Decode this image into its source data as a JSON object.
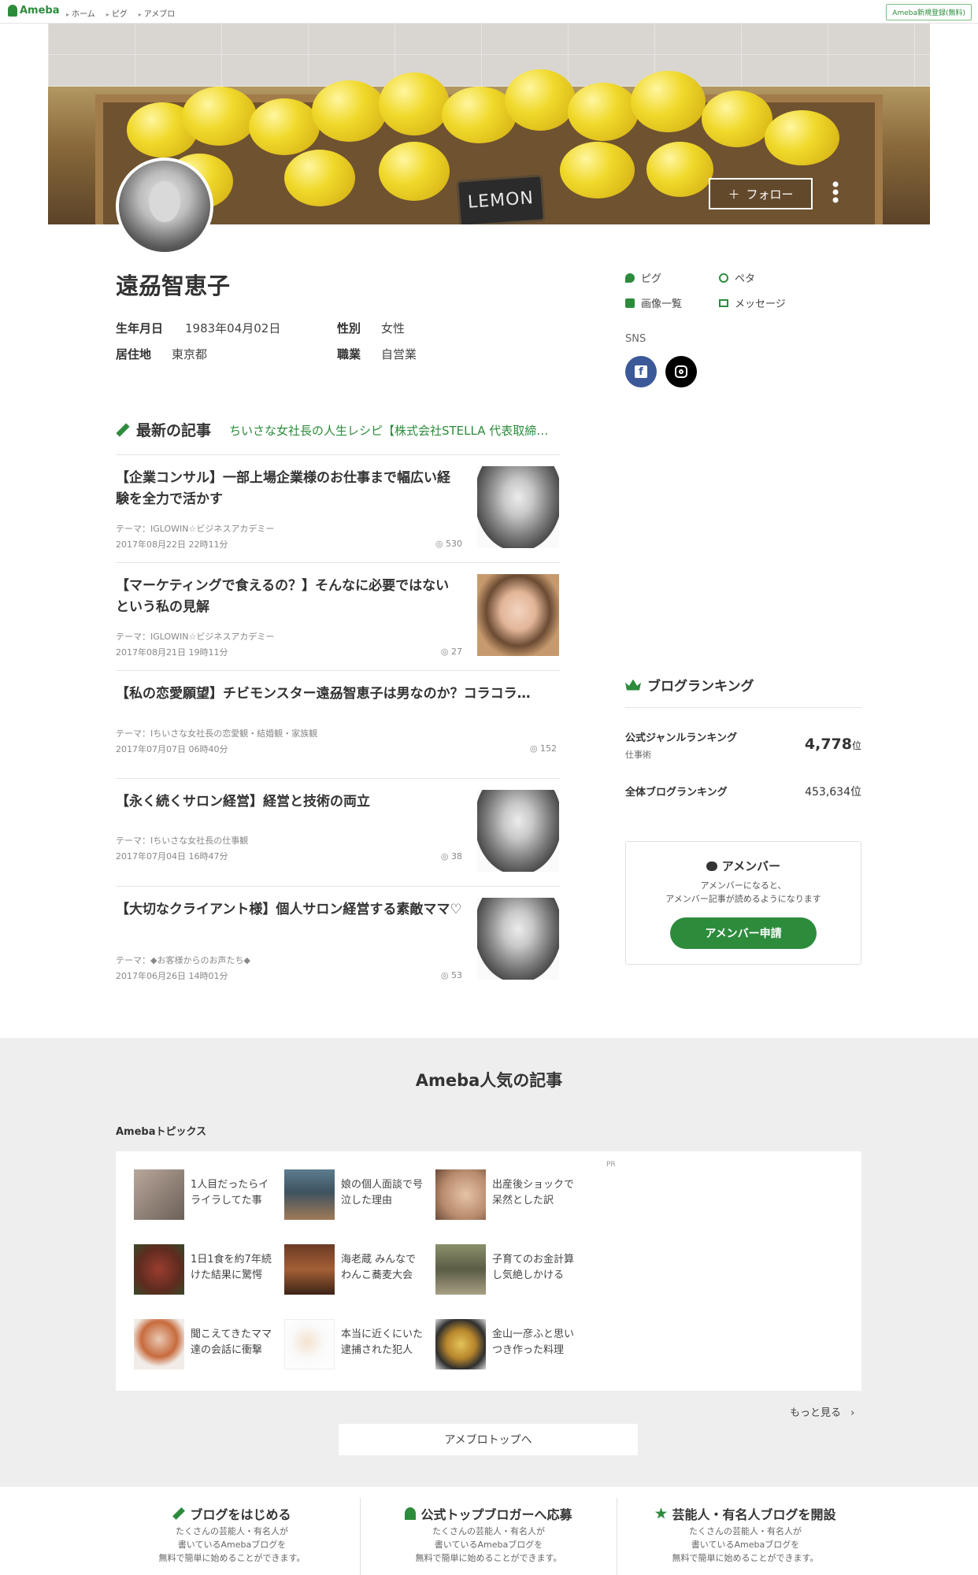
{
  "topbar": {
    "logo": "Ameba",
    "crumbs": [
      "ホーム",
      "ピグ",
      "アメブロ"
    ],
    "signup": "Ameba新規登録(無料)"
  },
  "header": {
    "sign_text": "LEMON",
    "follow_label": "フォロー",
    "follow_plus": "＋",
    "more": "⋮"
  },
  "profile": {
    "name": "遠刕智恵子",
    "birthday_label": "生年月日",
    "birthday": "1983年04月02日",
    "gender_label": "性別",
    "gender": "女性",
    "residence_label": "居住地",
    "residence": "東京都",
    "job_label": "職業",
    "job": "自営業"
  },
  "side_links": {
    "pig": "ピグ",
    "peta": "ペタ",
    "images": "画像一覧",
    "message": "メッセージ",
    "sns_label": "SNS"
  },
  "latest": {
    "title": "最新の記事",
    "blog_title": "ちいさな女社長の人生レシピ【株式会社STELLA 代表取締役 遠刕智恵子】",
    "articles": [
      {
        "title": "【企業コンサル】一部上場企業様のお仕事まで幅広い経験を全力で活かす",
        "theme": "テーマ：ⅠGLOWIN☆ビジネスアカデミー",
        "date": "2017年08月22日 22時11分",
        "views": "530"
      },
      {
        "title": "【マーケティングで食えるの？】そんなに必要ではないという私の見解",
        "theme": "テーマ：ⅠGLOWIN☆ビジネスアカデミー",
        "date": "2017年08月21日 19時11分",
        "views": "27"
      },
      {
        "title": "【私の恋愛願望】チビモンスター遠刕智恵子は男なのか？コラコラ…",
        "theme": "テーマ：Ⅰちいさな女社長の恋愛観・結婚観・家族観",
        "date": "2017年07月07日 06時40分",
        "views": "152"
      },
      {
        "title": "【永く続くサロン経営】経営と技術の両立",
        "theme": "テーマ：Ⅰちいさな女社長の仕事観",
        "date": "2017年07月04日 16時47分",
        "views": "38"
      },
      {
        "title": "【大切なクライアント様】個人サロン経営する素敵ママ♡",
        "theme": "テーマ：◆お客様からのお声たち◆",
        "date": "2017年06月26日 14時01分",
        "views": "53"
      }
    ]
  },
  "ranking": {
    "title": "ブログランキング",
    "genre_label": "公式ジャンルランキング",
    "genre_sub": "仕事術",
    "genre_rank": "4,778",
    "rank_unit": "位",
    "overall_label": "全体ブログランキング",
    "overall_rank": "453,634位"
  },
  "amember": {
    "title": "アメンバー",
    "desc_line1": "アメンバーになると、",
    "desc_line2": "アメンバー記事が読めるようになります",
    "button": "アメンバー申請"
  },
  "popular": {
    "title": "Ameba人気の記事",
    "topics_label": "Amebaトピックス",
    "pr": "PR",
    "topics": [
      [
        "1人目だったらイ",
        "ライラしてた事"
      ],
      [
        "娘の個人面談で号",
        "泣した理由"
      ],
      [
        "出産後ショックで",
        "呆然とした訳"
      ],
      [
        "1日1食を約7年続",
        "けた結果に驚愕"
      ],
      [
        "海老蔵 みんなで",
        "わんこ蕎麦大会"
      ],
      [
        "子育てのお金計算",
        "し気絶しかける"
      ],
      [
        "聞こえてきたママ",
        "達の会話に衝撃"
      ],
      [
        "本当に近くにいた",
        "逮捕された犯人"
      ],
      [
        "金山一彦ふと思い",
        "つき作った料理"
      ]
    ],
    "more": "もっと見る",
    "top_button": "アメブロトップへ"
  },
  "footer": {
    "promos": [
      {
        "title": "ブログをはじめる",
        "l1": "たくさんの芸能人・有名人が",
        "l2": "書いているAmebaブログを",
        "l3": "無料で簡単に始めることができます。"
      },
      {
        "title": "公式トップブロガーへ応募",
        "l1": "たくさんの芸能人・有名人が",
        "l2": "書いているAmebaブログを",
        "l3": "無料で簡単に始めることができます。"
      },
      {
        "title": "芸能人・有名人ブログを開設",
        "l1": "たくさんの芸能人・有名人が",
        "l2": "書いているAmebaブログを",
        "l3": "無料で簡単に始めることができます。"
      }
    ]
  },
  "colors": {
    "accent": "#2d8c3c",
    "facebook": "#3b5998",
    "instagram": "#000000"
  },
  "icons": [
    "pig-icon",
    "peta-icon",
    "camera-icon",
    "mail-icon",
    "facebook-icon",
    "instagram-icon",
    "pencil-icon",
    "crown-icon",
    "chat-icon",
    "chevron-right-icon"
  ]
}
